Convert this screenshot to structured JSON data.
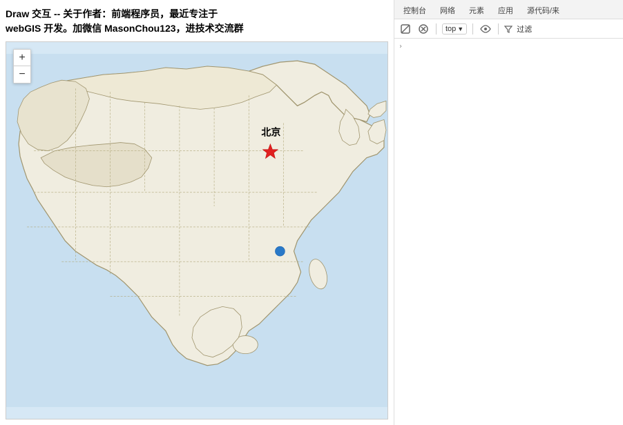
{
  "description": {
    "line1": "Draw 交互 -- 关于作者：前端程序员，最近专注于",
    "line2": "webGIS 开发。加微信 MasonChou123，进技术交流群"
  },
  "map": {
    "zoom_in_label": "+",
    "zoom_out_label": "−",
    "beijing_label": "北京"
  },
  "devtools": {
    "tabs": [
      {
        "label": "控制台",
        "active": true
      },
      {
        "label": "网络",
        "active": false
      },
      {
        "label": "元素",
        "active": false
      },
      {
        "label": "应用",
        "active": false
      },
      {
        "label": "源代码/来",
        "active": false
      }
    ],
    "toolbar": {
      "top_value": "top",
      "filter_label": "过滤"
    }
  }
}
